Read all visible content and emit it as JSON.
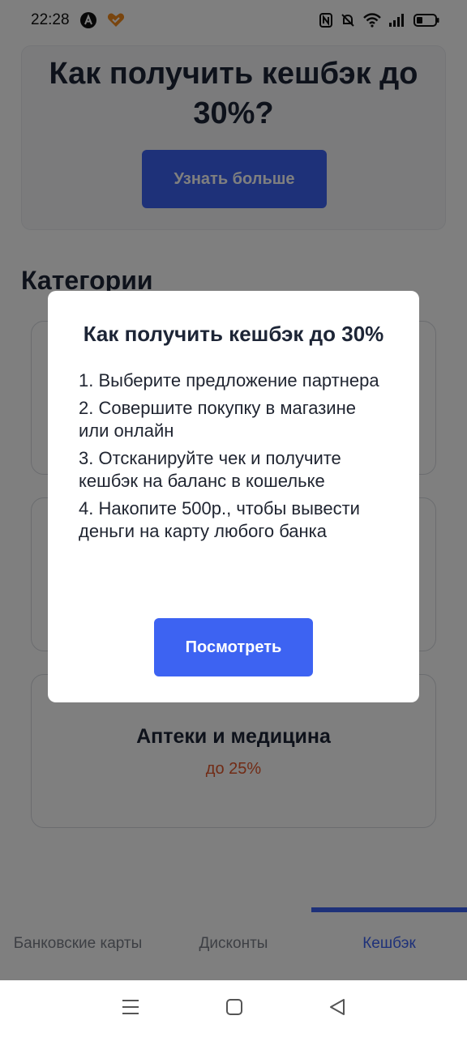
{
  "status_bar": {
    "time": "22:28"
  },
  "promo": {
    "title": "Как получить кешбэк до 30%?",
    "button_label": "Узнать больше"
  },
  "categories": {
    "title": "Категории",
    "items": [
      {
        "name": "",
        "cashback": ""
      },
      {
        "name": "",
        "cashback": ""
      },
      {
        "name": "Аптеки и медицина",
        "cashback": "до 25%"
      }
    ]
  },
  "modal": {
    "title": "Как получить кешбэк до 30%",
    "steps": [
      "1. Выберите предложение партнера",
      "2. Совершите покупку в магазине или онлайн",
      "3. Отсканируйте чек и получите кешбэк на баланс в кошельке",
      "4. Накопите 500р., чтобы вывести деньги на карту любого банка"
    ],
    "button_label": "Посмотреть"
  },
  "tabs": [
    {
      "label": "Банковские карты",
      "active": false
    },
    {
      "label": "Дисконты",
      "active": false
    },
    {
      "label": "Кешбэк",
      "active": true
    }
  ],
  "colors": {
    "accent": "#3d63f2",
    "cashback_text": "#e2562a",
    "text_dark": "#1d2536"
  },
  "icons": {
    "status_left": [
      "app-a-icon",
      "heart-app-icon"
    ],
    "status_right": [
      "nfc-icon",
      "mute-bell-icon",
      "wifi-icon",
      "signal-icon",
      "battery-icon"
    ],
    "navbar": [
      "menu-icon",
      "home-square-icon",
      "back-triangle-icon"
    ]
  }
}
